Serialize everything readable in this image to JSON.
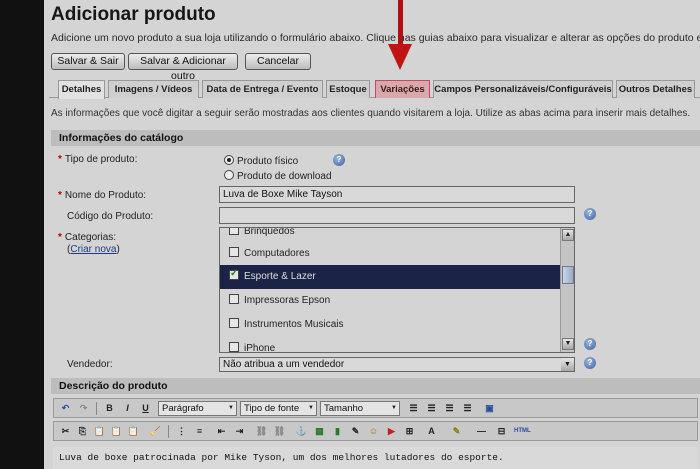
{
  "page": {
    "title": "Adicionar produto",
    "subtitle": "Adicione um novo produto a sua loja utilizando o formulário abaixo. Clique nas guias abaixo para visualizar e alterar as opções do produto e atributos."
  },
  "actions": {
    "save_exit": "Salvar & Sair",
    "save_add": "Salvar & Adicionar outro",
    "cancel": "Cancelar"
  },
  "tabs": [
    {
      "label": "Detalhes",
      "active": true
    },
    {
      "label": "Imagens / Vídeos"
    },
    {
      "label": "Data de Entrega / Evento"
    },
    {
      "label": "Estoque"
    },
    {
      "label": "Variações",
      "highlight": true
    },
    {
      "label": "Campos Personalizáveis/Configuráveis"
    },
    {
      "label": "Outros Detalhes"
    }
  ],
  "info_line": "As informações que você digitar a seguir serão mostradas aos clientes quando visitarem a loja. Utilize as abas acima para inserir mais detalhes.",
  "catalog": {
    "section_title": "Informações do catálogo",
    "product_type_label": "Tipo de produto:",
    "product_type_options": [
      "Produto físico",
      "Produto de download"
    ],
    "product_type_selected": 0,
    "name_label": "Nome do Produto:",
    "name_value": "Luva de Boxe Mike Tayson",
    "code_label": "Código do Produto:",
    "code_value": "",
    "categories_label": "Categorias:",
    "create_new_link": "Criar nova",
    "categories": [
      {
        "label": "Brinquedos",
        "checked": false
      },
      {
        "label": "Computadores",
        "checked": false
      },
      {
        "label": "Esporte & Lazer",
        "checked": true,
        "selected": true
      },
      {
        "label": "Impressoras Epson",
        "checked": false
      },
      {
        "label": "Instrumentos Musicais",
        "checked": false
      },
      {
        "label": "iPhone",
        "checked": false
      }
    ],
    "vendor_label": "Vendedor:",
    "vendor_value": "Não atribua a um vendedor"
  },
  "description": {
    "section_title": "Descrição do produto",
    "toolbar": {
      "paragraph": "Parágrafo",
      "font_type": "Tipo de fonte",
      "size": "Tamanho"
    },
    "text": "Luva de boxe patrocinada por Mike Tyson, um dos melhores lutadores do esporte."
  },
  "colors": {
    "highlight_tab": "#d8a9ab",
    "arrow": "#c01414",
    "selected_row": "#1b2346"
  }
}
